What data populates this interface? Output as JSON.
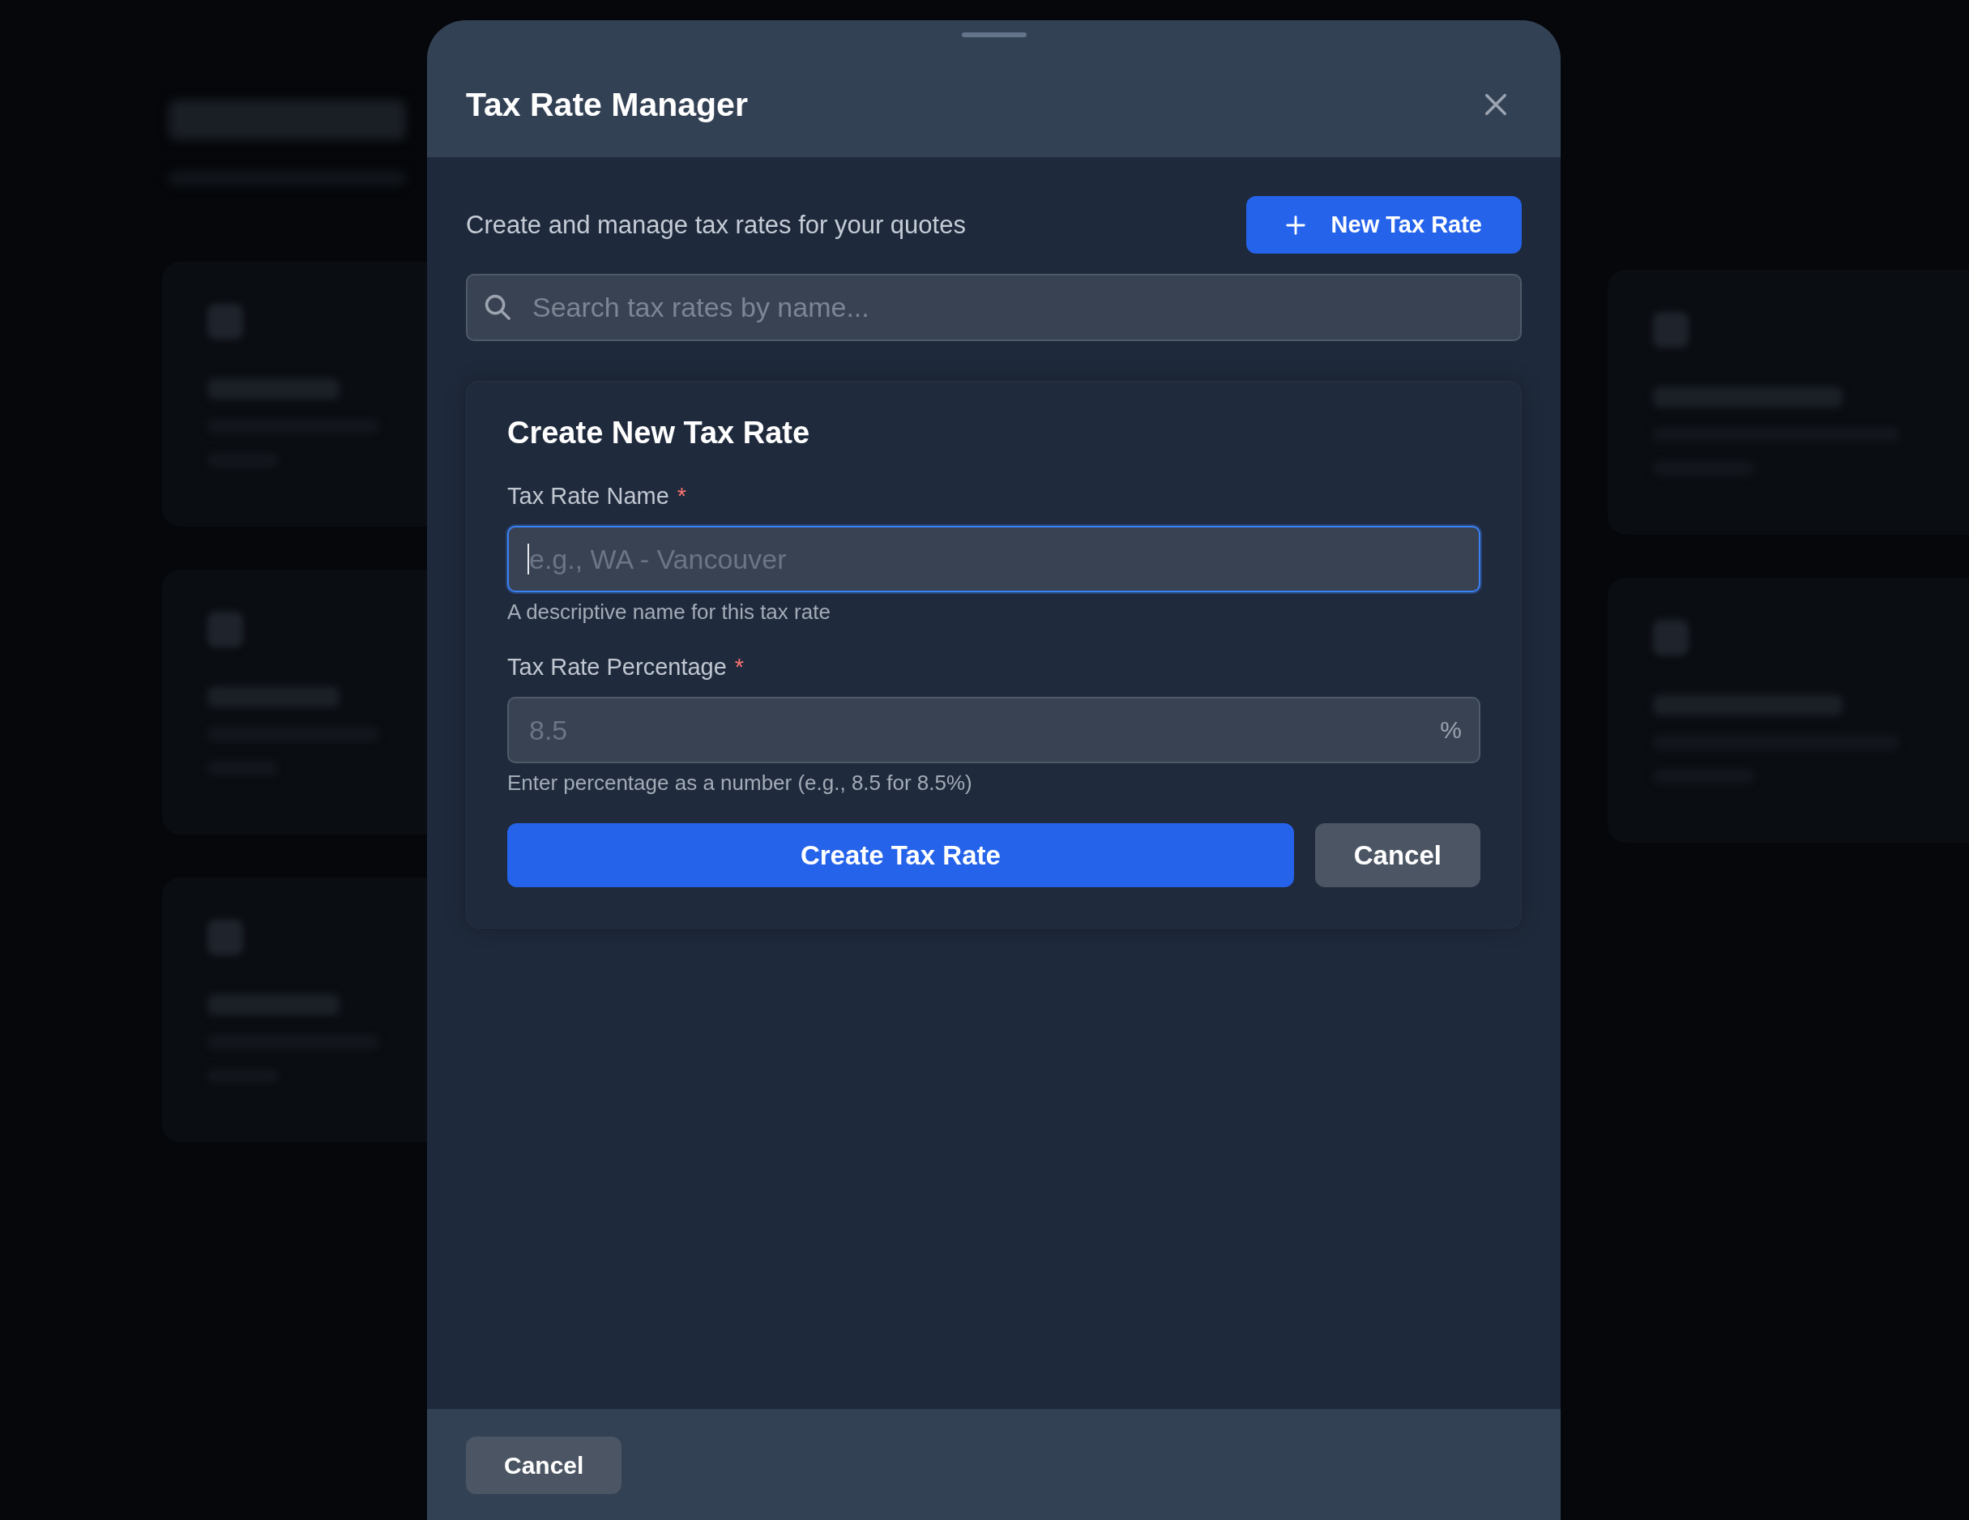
{
  "modal": {
    "title": "Tax Rate Manager"
  },
  "intro": {
    "text": "Create and manage tax rates for your quotes",
    "new_button": "New Tax Rate"
  },
  "search": {
    "placeholder": "Search tax rates by name..."
  },
  "form": {
    "title": "Create New Tax Rate",
    "fields": [
      {
        "label": "Tax Rate Name",
        "required_mark": "*",
        "placeholder": "e.g., WA - Vancouver",
        "hint": "A descriptive name for this tax rate",
        "focused": true
      },
      {
        "label": "Tax Rate Percentage",
        "required_mark": "*",
        "placeholder": "8.5",
        "suffix": "%",
        "hint": "Enter percentage as a number (e.g., 8.5 for 8.5%)",
        "focused": false
      }
    ],
    "buttons": [
      {
        "kind": "primary",
        "label": "Create Tax Rate"
      },
      {
        "kind": "secondary",
        "label": "Cancel"
      }
    ]
  },
  "footer": {
    "buttons": [
      {
        "kind": "secondary",
        "label": "Cancel"
      }
    ]
  }
}
